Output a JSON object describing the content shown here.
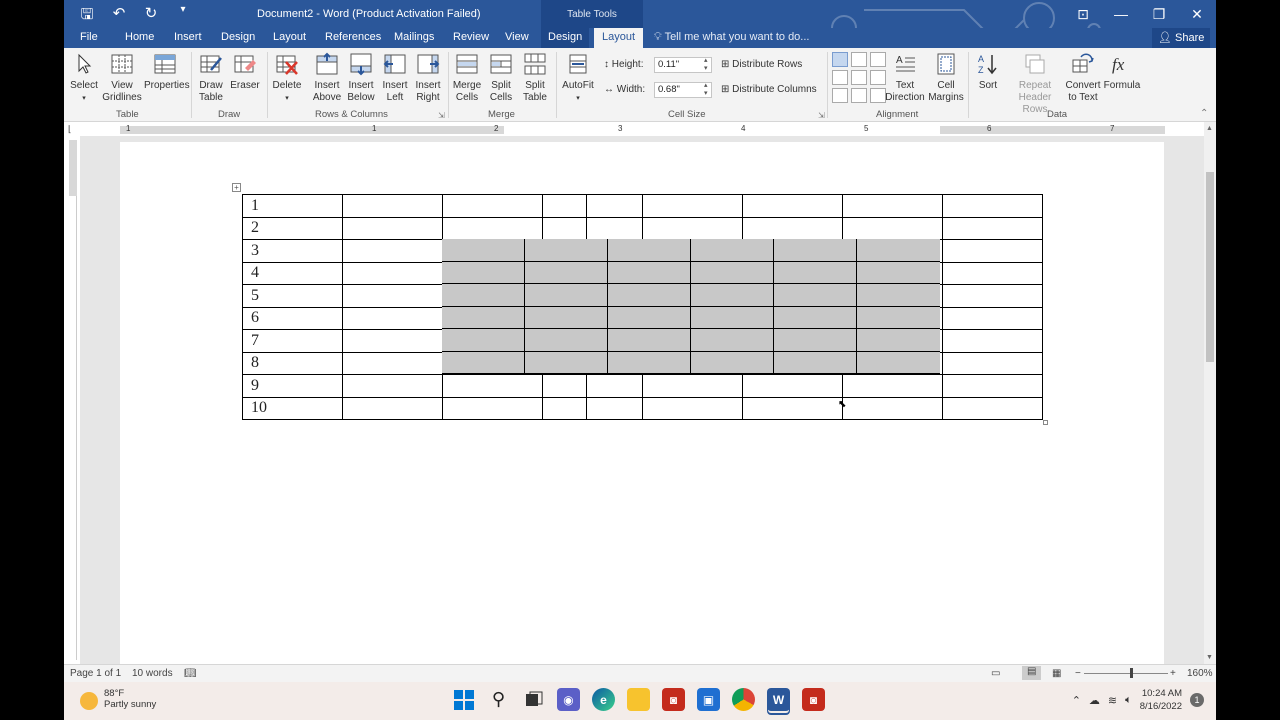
{
  "title_bar": {
    "doc_title": "Document2 - Word (Product Activation Failed)",
    "context_label": "Table Tools"
  },
  "tabs": [
    "File",
    "Home",
    "Insert",
    "Design",
    "Layout",
    "References",
    "Mailings",
    "Review",
    "View",
    "Design",
    "Layout"
  ],
  "tell_me": "Tell me what you want to do...",
  "share": "Share",
  "ribbon": {
    "table": {
      "select": "Select",
      "view_gridlines_1": "View",
      "view_gridlines_2": "Gridlines",
      "properties": "Properties",
      "label": "Table"
    },
    "draw": {
      "draw_table_1": "Draw",
      "draw_table_2": "Table",
      "eraser": "Eraser",
      "label": "Draw"
    },
    "rows_cols": {
      "delete": "Delete",
      "insert_above_1": "Insert",
      "insert_above_2": "Above",
      "insert_below_1": "Insert",
      "insert_below_2": "Below",
      "insert_left_1": "Insert",
      "insert_left_2": "Left",
      "insert_right_1": "Insert",
      "insert_right_2": "Right",
      "label": "Rows & Columns"
    },
    "merge": {
      "merge_cells_1": "Merge",
      "merge_cells_2": "Cells",
      "split_cells_1": "Split",
      "split_cells_2": "Cells",
      "split_table_1": "Split",
      "split_table_2": "Table",
      "label": "Merge"
    },
    "cell_size": {
      "autofit": "AutoFit",
      "height_label": "Height:",
      "height_value": "0.11\"",
      "width_label": "Width:",
      "width_value": "0.68\"",
      "distribute_rows": "Distribute Rows",
      "distribute_columns": "Distribute Columns",
      "label": "Cell Size"
    },
    "alignment": {
      "text_direction_1": "Text",
      "text_direction_2": "Direction",
      "cell_margins_1": "Cell",
      "cell_margins_2": "Margins",
      "label": "Alignment"
    },
    "data": {
      "sort": "Sort",
      "repeat_header_1": "Repeat",
      "repeat_header_2": "Header Rows",
      "convert_1": "Convert",
      "convert_2": "to Text",
      "formula": "Formula",
      "label": "Data"
    }
  },
  "ruler_numbers": [
    "1",
    "1",
    "2",
    "3",
    "4",
    "5",
    "6",
    "7"
  ],
  "table_rows": [
    "1",
    "2",
    "3",
    "4",
    "5",
    "6",
    "7",
    "8",
    "9",
    "10"
  ],
  "status": {
    "page": "Page 1 of 1",
    "words": "10 words",
    "zoom": "160%"
  },
  "taskbar": {
    "temp": "88°F",
    "weather": "Partly sunny",
    "time": "10:24 AM",
    "date": "8/16/2022"
  },
  "colors": {
    "word_blue": "#2b579a",
    "selection_grey": "#c8c8c8"
  }
}
